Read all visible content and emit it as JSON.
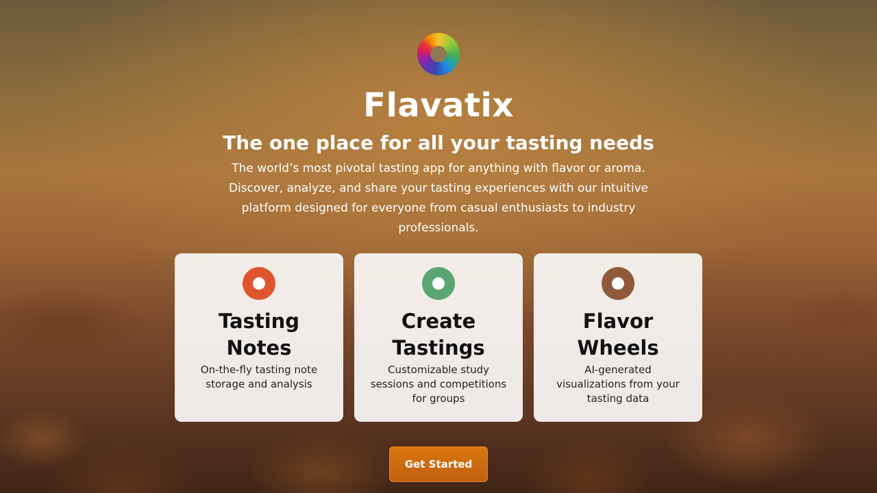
{
  "app": {
    "title": "Flavatix",
    "tagline": "The one place for all your tasting needs",
    "description": "The world’s most pivotal tasting app for anything with flavor or aroma. Discover, analyze, and share your tasting experiences with our intuitive platform designed for everyone from casual enthusiasts to industry professionals."
  },
  "logo": {
    "icon": "color-wheel-logo"
  },
  "features": [
    {
      "title": "Tasting Notes",
      "description": "On-the-fly tasting note storage and analysis",
      "icon": "ring-icon",
      "color": "#e0552f"
    },
    {
      "title": "Create Tastings",
      "description": "Customizable study sessions and competitions for groups",
      "icon": "ring-icon",
      "color": "#5aa572"
    },
    {
      "title": "Flavor Wheels",
      "description": "AI-generated visualizations from your tasting data",
      "icon": "ring-icon",
      "color": "#8e5a3a"
    }
  ],
  "cta": {
    "label": "Get Started",
    "color": "#d0700f"
  }
}
